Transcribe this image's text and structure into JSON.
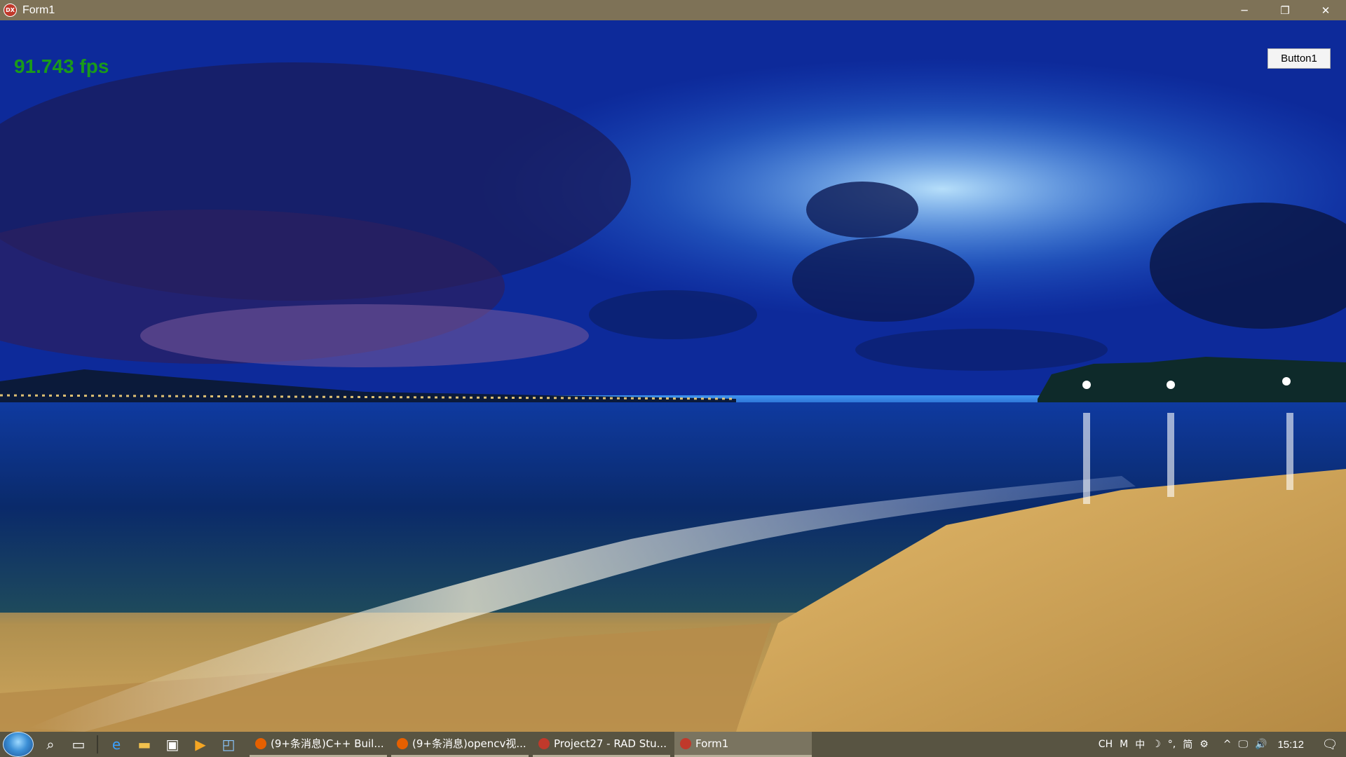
{
  "window": {
    "title": "Form1",
    "app_icon": "DX",
    "controls": {
      "minimize": "─",
      "restore": "❐",
      "close": "✕"
    }
  },
  "form": {
    "fps_label": "91.743 fps",
    "button1_label": "Button1"
  },
  "taskbar": {
    "start_icon": "windows-start-orb",
    "pinned": [
      {
        "name": "search-icon",
        "glyph": "⌕"
      },
      {
        "name": "task-view-icon",
        "glyph": "▭"
      },
      {
        "name": "edge-icon",
        "glyph": "e"
      },
      {
        "name": "file-explorer-icon",
        "glyph": "▬"
      },
      {
        "name": "store-icon",
        "glyph": "▣"
      },
      {
        "name": "media-icon",
        "glyph": "▶"
      },
      {
        "name": "app-icon",
        "glyph": "◰"
      }
    ],
    "tasks": [
      {
        "label": "(9+条消息)C++ Buil...",
        "icon_color": "#e66000",
        "active": false
      },
      {
        "label": "(9+条消息)opencv视...",
        "icon_color": "#e66000",
        "active": false
      },
      {
        "label": "Project27 - RAD Stu...",
        "icon_color": "#c0392b",
        "icon_text": "DX",
        "active": false
      },
      {
        "label": "Form1",
        "icon_color": "#c0392b",
        "icon_text": "DX",
        "active": true
      }
    ],
    "tray": {
      "ime": [
        "CH",
        "M",
        "中",
        "☽",
        "°,",
        "简",
        "⚙"
      ],
      "chevron": "^",
      "network": "🖵",
      "volume": "🔊",
      "clock": "15:12",
      "notifications": "🗨"
    }
  }
}
